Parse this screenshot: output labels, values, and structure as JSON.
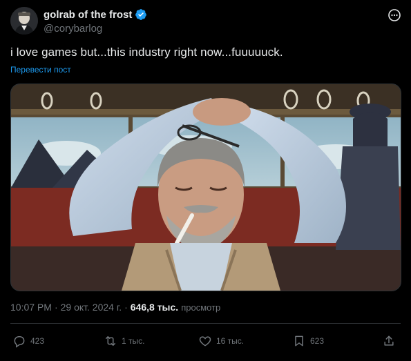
{
  "author": {
    "display_name": "golrab of the frost",
    "handle": "@corybarlog",
    "avatar_icon": "user-avatar",
    "verified_color": "#1d9bf0"
  },
  "tweet": {
    "text": "i love games but...this industry right now...fuuuuuck.",
    "translate_label": "Перевести пост"
  },
  "meta": {
    "time": "10:07 PM",
    "separator": "·",
    "date": "29 окт. 2024 г.",
    "views_count": "646,8 тыс.",
    "views_label": "просмотр"
  },
  "actions": {
    "replies": "423",
    "reposts": "1 тыс.",
    "likes": "16 тыс.",
    "bookmarks": "623"
  },
  "colors": {
    "background": "#000000",
    "text": "#e7e9ea",
    "muted": "#71767b",
    "accent": "#1d9bf0",
    "border": "#2f3336"
  }
}
